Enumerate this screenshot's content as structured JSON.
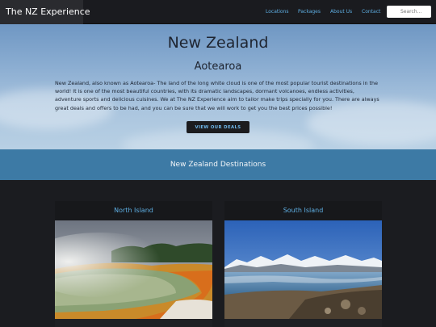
{
  "navbar": {
    "brand": "The NZ Experience",
    "links": [
      "Locations",
      "Packages",
      "About Us",
      "Contact"
    ],
    "search_placeholder": "Search..."
  },
  "hero": {
    "title": "New Zealand",
    "subtitle": "Aotearoa",
    "description": "New Zealand, also known as Aotearoa- The land of the long white cloud is one of the most popular tourist destinations in the world! It is one of the most beautiful countries, with its dramatic landscapes, dormant volcanoes, endless activities, adventure sports and delicious cuisines. We at The NZ Experience aim to tailor make trips specially for you. There are always great deals and offers to be had, and you can be sure that we will work to get you the best prices possible!",
    "cta_label": "VIEW OUR DEALS"
  },
  "destinations": {
    "heading": "New Zealand Destinations",
    "cards": [
      {
        "title": "North Island",
        "image": "geothermal-pool-image"
      },
      {
        "title": "South Island",
        "image": "mountain-lake-image"
      }
    ]
  },
  "colors": {
    "accent": "#5eaee2",
    "band": "#3d7aa5",
    "navbar": "#1a1b1f",
    "background": "#1b1c20"
  }
}
